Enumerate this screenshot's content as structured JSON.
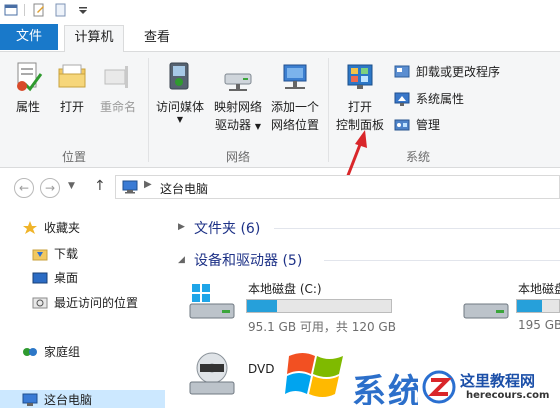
{
  "ribbon_tabs": {
    "file": "文件",
    "computer": "计算机",
    "view": "查看"
  },
  "ribbon": {
    "location_group": {
      "label": "位置",
      "properties": "属性",
      "open": "打开",
      "rename": "重命名"
    },
    "network_group": {
      "label": "网络",
      "access_media": "访问媒体",
      "map_drive_1": "映射网络",
      "map_drive_2": "驱动器",
      "add_location_1": "添加一个",
      "add_location_2": "网络位置"
    },
    "system_group": {
      "label": "系统",
      "open_cp_1": "打开",
      "open_cp_2": "控制面板",
      "uninstall": "卸载或更改程序",
      "sys_props": "系统属性",
      "manage": "管理"
    }
  },
  "address": {
    "path": "这台电脑"
  },
  "nav": {
    "favorites": "收藏夹",
    "downloads": "下载",
    "desktop": "桌面",
    "recent": "最近访问的位置",
    "homegroup": "家庭组",
    "this_pc": "这台电脑"
  },
  "content": {
    "folders_section": "文件夹 (6)",
    "devices_section": "设备和驱动器 (5)",
    "drive_c": {
      "name": "本地磁盘 (C:)",
      "info": "95.1 GB 可用，共 120 GB",
      "used_fraction": 0.21
    },
    "drive_2": {
      "name": "本地磁盘",
      "info": "195 GB"
    },
    "dvd": {
      "name": "DVD"
    }
  },
  "watermark": {
    "left_text": "系统之家",
    "right_text_1": "这里教程网",
    "right_text_2": "herecours.com"
  },
  "colors": {
    "accent": "#1979ca",
    "bar_fill": "#26a0da",
    "arrow": "#d9262a"
  }
}
